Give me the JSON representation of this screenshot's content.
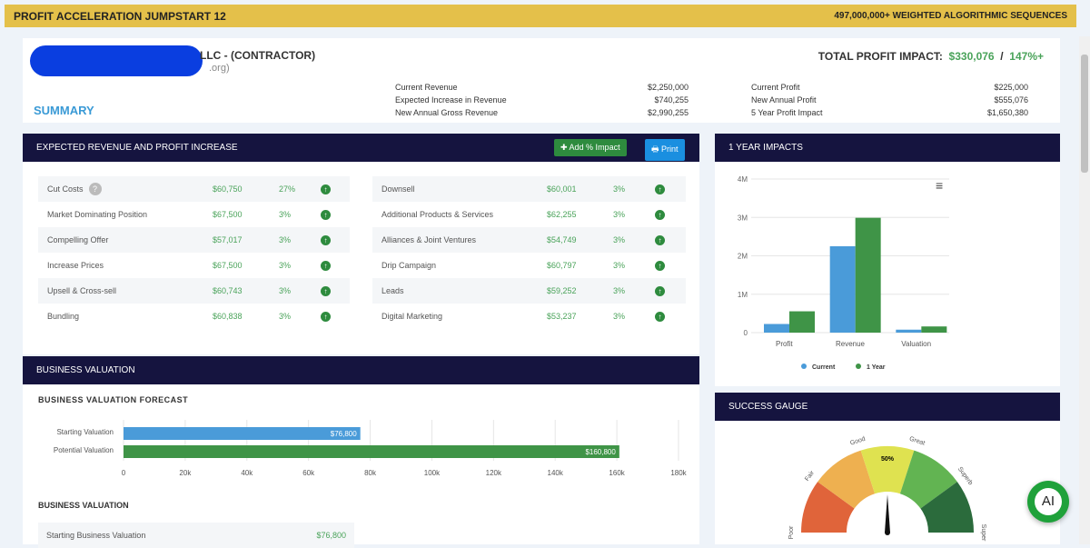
{
  "topbar": {
    "title": "PROFIT ACCELERATION JUMPSTART 12",
    "tagline": "497,000,000+ WEIGHTED ALGORITHMIC SEQUENCES"
  },
  "header": {
    "company": "LLC - (CONTRACTOR)",
    "email_suffix": ".org)",
    "summary": "SUMMARY",
    "total_label": "TOTAL PROFIT IMPACT:",
    "total_value": "$330,076",
    "separator": "/",
    "total_pct": "147%+",
    "revenue": [
      {
        "label": "Current Revenue",
        "value": "$2,250,000"
      },
      {
        "label": "Expected Increase in Revenue",
        "value": "$740,255"
      },
      {
        "label": "New Annual Gross Revenue",
        "value": "$2,990,255"
      }
    ],
    "profit": [
      {
        "label": "Current Profit",
        "value": "$225,000"
      },
      {
        "label": "New Annual Profit",
        "value": "$555,076"
      },
      {
        "label": "5 Year Profit Impact",
        "value": "$1,650,380"
      }
    ]
  },
  "expected": {
    "title": "EXPECTED REVENUE AND PROFIT INCREASE",
    "add_label": "✚ Add % Impact",
    "print_label": "🖶 Print",
    "help": "?",
    "left": [
      {
        "name": "Cut Costs",
        "value": "$60,750",
        "pct": "27%"
      },
      {
        "name": "Market Dominating Position",
        "value": "$67,500",
        "pct": "3%"
      },
      {
        "name": "Compelling Offer",
        "value": "$57,017",
        "pct": "3%"
      },
      {
        "name": "Increase Prices",
        "value": "$67,500",
        "pct": "3%"
      },
      {
        "name": "Upsell & Cross-sell",
        "value": "$60,743",
        "pct": "3%"
      },
      {
        "name": "Bundling",
        "value": "$60,838",
        "pct": "3%"
      }
    ],
    "right": [
      {
        "name": "Downsell",
        "value": "$60,001",
        "pct": "3%"
      },
      {
        "name": "Additional Products & Services",
        "value": "$62,255",
        "pct": "3%"
      },
      {
        "name": "Alliances & Joint Ventures",
        "value": "$54,749",
        "pct": "3%"
      },
      {
        "name": "Drip Campaign",
        "value": "$60,797",
        "pct": "3%"
      },
      {
        "name": "Leads",
        "value": "$59,252",
        "pct": "3%"
      },
      {
        "name": "Digital Marketing",
        "value": "$53,237",
        "pct": "3%"
      }
    ]
  },
  "impacts": {
    "title": "1 YEAR IMPACTS"
  },
  "valuation": {
    "title": "BUSINESS VALUATION",
    "forecast_title": "BUSINESS VALUATION FORECAST",
    "sub_title": "BUSINESS VALUATION",
    "starting_label": "Starting Business Valuation",
    "starting_value": "$76,800"
  },
  "gauge": {
    "title": "SUCCESS GAUGE",
    "value_pct": 50,
    "value_label": "50%",
    "bands": [
      "Poor",
      "Fair",
      "Good",
      "Great",
      "Superb",
      "Super"
    ]
  },
  "ai_label": "AI",
  "chart_data": [
    {
      "type": "bar",
      "title": "1 YEAR IMPACTS",
      "categories": [
        "Profit",
        "Revenue",
        "Valuation"
      ],
      "series": [
        {
          "name": "Current",
          "color": "#4a9bd9",
          "values": [
            225000,
            2250000,
            76800
          ]
        },
        {
          "name": "1 Year",
          "color": "#3f9447",
          "values": [
            555076,
            2990255,
            160800
          ]
        }
      ],
      "yticks": [
        "0",
        "1M",
        "2M",
        "3M",
        "4M"
      ],
      "ylim": [
        0,
        4000000
      ],
      "legend": "bottom"
    },
    {
      "type": "bar",
      "orientation": "horizontal",
      "title": "BUSINESS VALUATION FORECAST",
      "categories": [
        "Starting Valuation",
        "Potential Valuation"
      ],
      "values": [
        76800,
        160800
      ],
      "labels": [
        "$76,800",
        "$160,800"
      ],
      "colors": [
        "#4a9bd9",
        "#3f9447"
      ],
      "xticks": [
        "0",
        "20k",
        "40k",
        "60k",
        "80k",
        "100k",
        "120k",
        "140k",
        "160k",
        "180k"
      ],
      "xlim": [
        0,
        180000
      ]
    }
  ]
}
